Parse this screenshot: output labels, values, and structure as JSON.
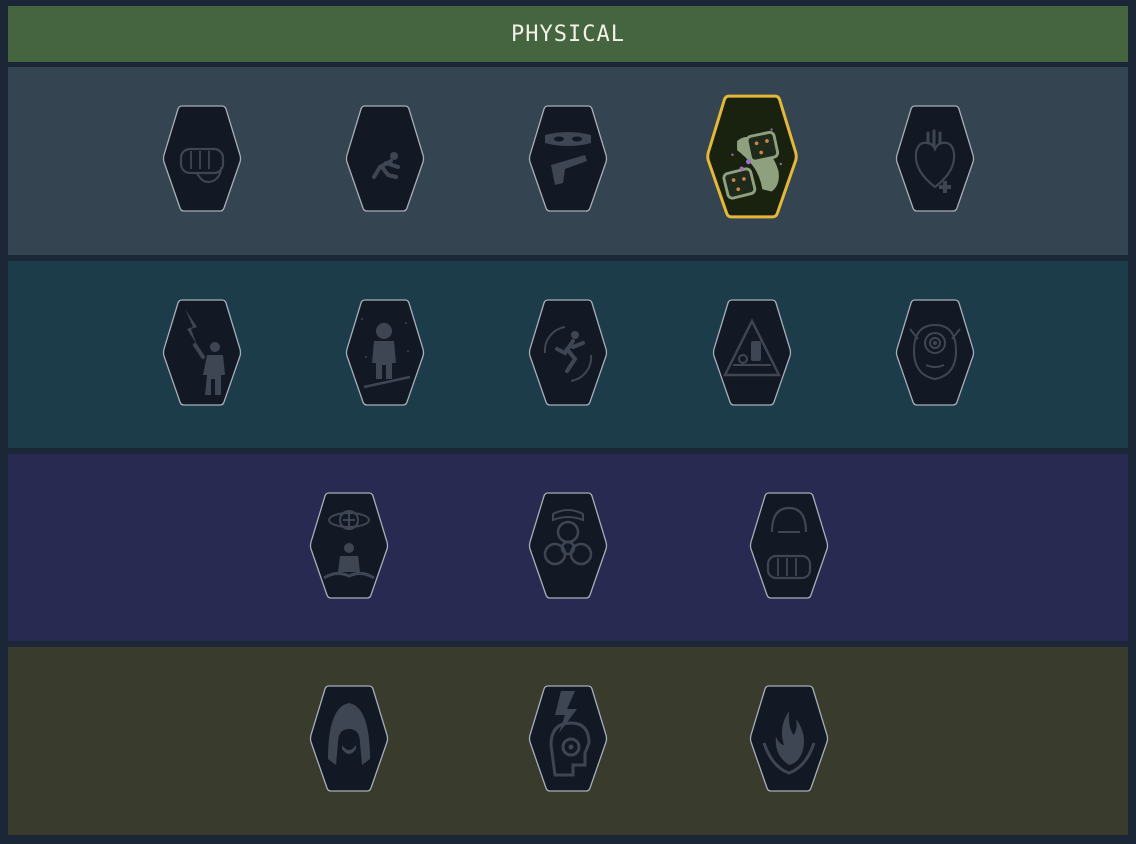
{
  "header": {
    "title": "PHYSICAL"
  },
  "colors": {
    "header_bg": "#456440",
    "tier_1": "#344551",
    "tier_2": "#1c3c49",
    "tier_3": "#282a52",
    "tier_4": "#393c2d",
    "badge_fill": "#121925",
    "badge_outline": "#a8aeb8",
    "selected_outline": "#e6b838",
    "selected_icon": "#8ea07e"
  },
  "tiers": [
    {
      "name": "tier-1",
      "skills": [
        {
          "icon": "fist-icon",
          "selected": false
        },
        {
          "icon": "crouching-runner-icon",
          "selected": false
        },
        {
          "icon": "masked-gunman-icon",
          "selected": false
        },
        {
          "icon": "dice-hand-icon",
          "selected": true
        },
        {
          "icon": "heart-plus-icon",
          "selected": false
        }
      ]
    },
    {
      "name": "tier-2",
      "skills": [
        {
          "icon": "lightning-strike-icon",
          "selected": false
        },
        {
          "icon": "astronaut-icon",
          "selected": false
        },
        {
          "icon": "flying-kick-icon",
          "selected": false
        },
        {
          "icon": "hazard-triangle-icon",
          "selected": false
        },
        {
          "icon": "focus-head-icon",
          "selected": false
        }
      ]
    },
    {
      "name": "tier-3",
      "skills": [
        {
          "icon": "meditation-icon",
          "selected": false
        },
        {
          "icon": "biohazard-icon",
          "selected": false
        },
        {
          "icon": "cobra-fist-icon",
          "selected": false
        }
      ]
    },
    {
      "name": "tier-4",
      "skills": [
        {
          "icon": "hooded-figure-icon",
          "selected": false
        },
        {
          "icon": "electric-mind-icon",
          "selected": false
        },
        {
          "icon": "flame-hands-icon",
          "selected": false
        }
      ]
    }
  ]
}
